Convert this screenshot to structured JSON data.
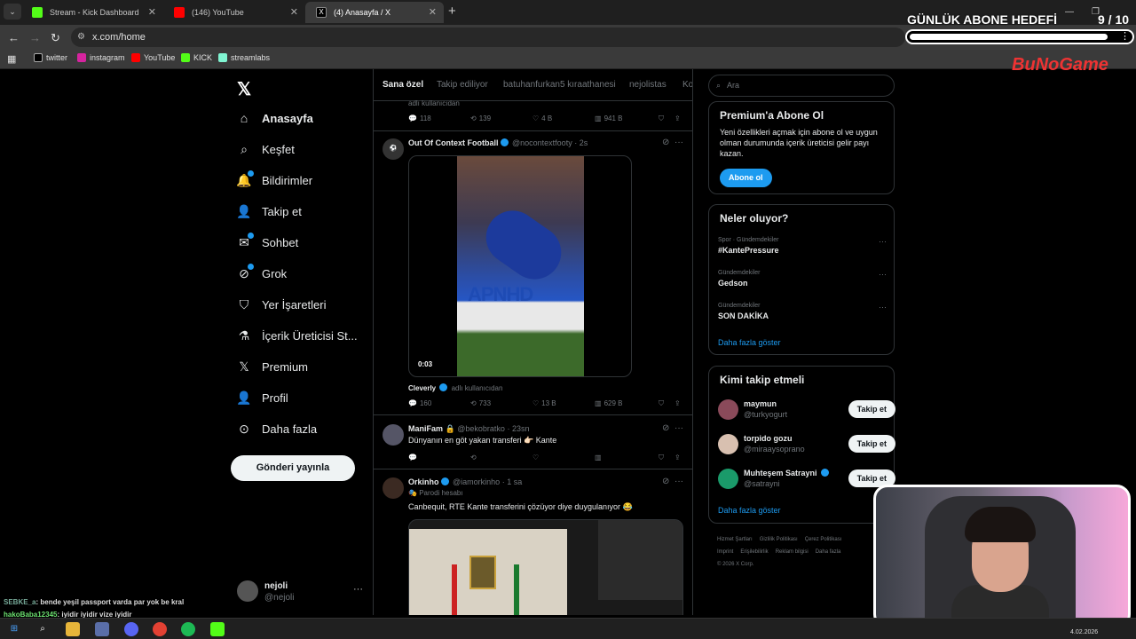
{
  "browser": {
    "tabs": [
      {
        "title": "Stream - Kick Dashboard",
        "color": "#53fc18"
      },
      {
        "title": "(146) YouTube",
        "color": "#ff0000"
      },
      {
        "title": "(4) Anasayfa / X",
        "color": "#ffffff"
      }
    ],
    "url": "x.com/home",
    "bookmarks": [
      "twitter",
      "instagram",
      "YouTube",
      "KICK",
      "streamlabs"
    ]
  },
  "overlay": {
    "title": "GÜNLÜK ABONE HEDEFİ",
    "count": "9 / 10",
    "progress": 0.9,
    "logo": "BuNoGame"
  },
  "sidebar": {
    "items": [
      {
        "label": "Anasayfa",
        "icon": "home-icon"
      },
      {
        "label": "Keşfet",
        "icon": "search-icon"
      },
      {
        "label": "Bildirimler",
        "icon": "bell-icon"
      },
      {
        "label": "Takip et",
        "icon": "person-add-icon"
      },
      {
        "label": "Sohbet",
        "icon": "mail-icon"
      },
      {
        "label": "Grok",
        "icon": "grok-icon"
      },
      {
        "label": "Yer İşaretleri",
        "icon": "bookmark-icon"
      },
      {
        "label": "İçerik Üreticisi St...",
        "icon": "flask-icon"
      },
      {
        "label": "Premium",
        "icon": "x-icon"
      },
      {
        "label": "Profil",
        "icon": "person-icon"
      },
      {
        "label": "Daha fazla",
        "icon": "more-circle-icon"
      }
    ],
    "post_button": "Gönderi yayınla",
    "me": {
      "name": "nejoli",
      "handle": "@nejoli"
    }
  },
  "feed": {
    "tabs": [
      "Sana özel",
      "Takip ediliyor",
      "batuhanfurkan5 kıraathanesi",
      "nejolistas",
      "Ko"
    ],
    "top_partial": {
      "sub": "adlı kullanıcıdan",
      "replies": "118",
      "reposts": "139",
      "likes": "4 B",
      "views": "941 B"
    },
    "tweet1": {
      "name": "Out Of Context Football",
      "handle": "@nocontextfooty",
      "time": "2s",
      "media_ad": "APNHD",
      "video_time": "0:03",
      "credit": "Cleverly",
      "credit_suffix": "adlı kullanıcıdan",
      "replies": "160",
      "reposts": "733",
      "likes": "13 B",
      "views": "629 B"
    },
    "tweet2": {
      "name": "ManiFam",
      "handle": "@bekobratko",
      "time": "23sn",
      "text": "Dünyanın en göt yakan transferi 👉🏻 Kante"
    },
    "tweet3": {
      "name": "Orkinho",
      "handle": "@iamorkinho",
      "time": "1 sa",
      "sub": "Parodi hesabı",
      "text": "Canbequit, RTE Kante transferini çözüyor diye duygulanıyor 😂"
    }
  },
  "right": {
    "search_placeholder": "Ara",
    "premium": {
      "title": "Premium'a Abone Ol",
      "text": "Yeni özellikleri açmak için abone ol ve uygun olman durumunda içerik üreticisi gelir payı kazan.",
      "button": "Abone ol"
    },
    "trends_title": "Neler oluyor?",
    "trends": [
      {
        "category": "Spor · Gündemdekiler",
        "topic": "#KantePressure"
      },
      {
        "category": "Gündemdekiler",
        "topic": "Gedson"
      },
      {
        "category": "Gündemdekiler",
        "topic": "SON DAKİKA"
      }
    ],
    "trends_more": "Daha fazla göster",
    "who_title": "Kimi takip etmeli",
    "who": [
      {
        "name": "maymun",
        "handle": "@turkyogurt",
        "button": "Takip et",
        "color": "#8a4a5a"
      },
      {
        "name": "torpido gozu",
        "handle": "@miraaysoprano",
        "button": "Takip et",
        "color": "#d8c0b0"
      },
      {
        "name": "Muhteşem Satrayni",
        "handle": "@satrayni",
        "button": "Takip et",
        "color": "#1a9a6a"
      }
    ],
    "who_more": "Daha fazla göster",
    "footer": [
      "Hizmet Şartları",
      "Gizlilik Politikası",
      "Çerez Politikası",
      "Imprint",
      "Erişilebilirlik",
      "Reklam bilgisi",
      "Daha fazla",
      "© 2026 X Corp."
    ]
  },
  "chat": [
    {
      "user": "SEBKE_a",
      "msg": ": bende yeşil passport varda par yok be kral"
    },
    {
      "user": "hakoBaba12345",
      "msg": ": iyidir iyidir vize iyidir"
    }
  ],
  "taskbar": {
    "date": "4.02.2026"
  }
}
